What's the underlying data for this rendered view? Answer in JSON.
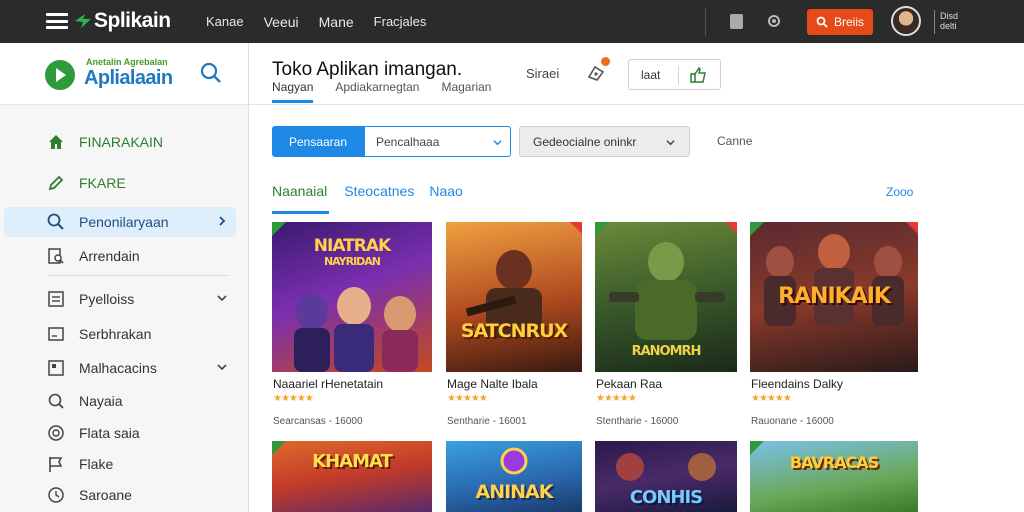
{
  "topbar": {
    "brand": "Splikain",
    "nav": [
      "Kanae",
      "Veeui",
      "Mane",
      "Fracjales"
    ],
    "button_label": "Breiis",
    "mini_text": [
      "Disd",
      "delti"
    ],
    "colors": {
      "bar": "#2b2b2b",
      "button": "#e64a19"
    }
  },
  "sidebar": {
    "brand_small": "Anetalin Agrebalan",
    "brand_name": "Aplialaain",
    "items": [
      {
        "label": "FINARAKAIN",
        "icon": "home-icon"
      },
      {
        "label": "FKARE",
        "icon": "pencil-icon"
      },
      {
        "label": "Penonilaryaan",
        "icon": "search-icon"
      },
      {
        "label": "Arrendain",
        "icon": "search-doc-icon"
      },
      {
        "label": "Pyelloiss",
        "icon": "list-icon"
      },
      {
        "label": "Serbhrakan",
        "icon": "box-icon"
      },
      {
        "label": "Malhacacins",
        "icon": "tag-icon"
      },
      {
        "label": "Nayaia",
        "icon": "search-icon"
      },
      {
        "label": "Flata saia",
        "icon": "help-icon"
      },
      {
        "label": "Flake",
        "icon": "flag-icon"
      },
      {
        "label": "Saroane",
        "icon": "clock-icon"
      }
    ]
  },
  "header": {
    "title": "Toko Aplikan imangan.",
    "subtabs": [
      "Nagyan",
      "Apdiakarnegtan",
      "Magarian"
    ],
    "label": "Siraei",
    "box_label": "laat"
  },
  "filters": {
    "primary_label": "Pensaaran",
    "select1_value": "Pencalhaaa",
    "select2_value": "Gedeocialne oninkr",
    "link": "Canne"
  },
  "categories": {
    "tabs": [
      "Naanaial",
      "Steocatnes",
      "Naao"
    ],
    "more": "Zooo"
  },
  "cards": [
    {
      "name": "Naaariel rHenetatain",
      "meta": "Searcansas - 16000",
      "art_title": "NIATRAK",
      "art_sub": "NAYRIDAN"
    },
    {
      "name": "Mage Nalte Ibala",
      "meta": "Sentharie - 16001",
      "art_title": "SATCNRUX",
      "art_sub": ""
    },
    {
      "name": "Pekaan Raa",
      "meta": "Stentharie - 16000",
      "art_title": "RANOMRH",
      "art_sub": ""
    },
    {
      "name": "Fleendains Dalky",
      "meta": "Rauonane - 16000",
      "art_title": "RANIKAIK",
      "art_sub": ""
    },
    {
      "name": "",
      "meta": "",
      "art_title": "KHAMAT",
      "art_sub": ""
    },
    {
      "name": "",
      "meta": "",
      "art_title": "ANINAK",
      "art_sub": ""
    },
    {
      "name": "",
      "meta": "",
      "art_title": "CONHIS",
      "art_sub": ""
    },
    {
      "name": "",
      "meta": "",
      "art_title": "BAVRACAS",
      "art_sub": ""
    }
  ]
}
